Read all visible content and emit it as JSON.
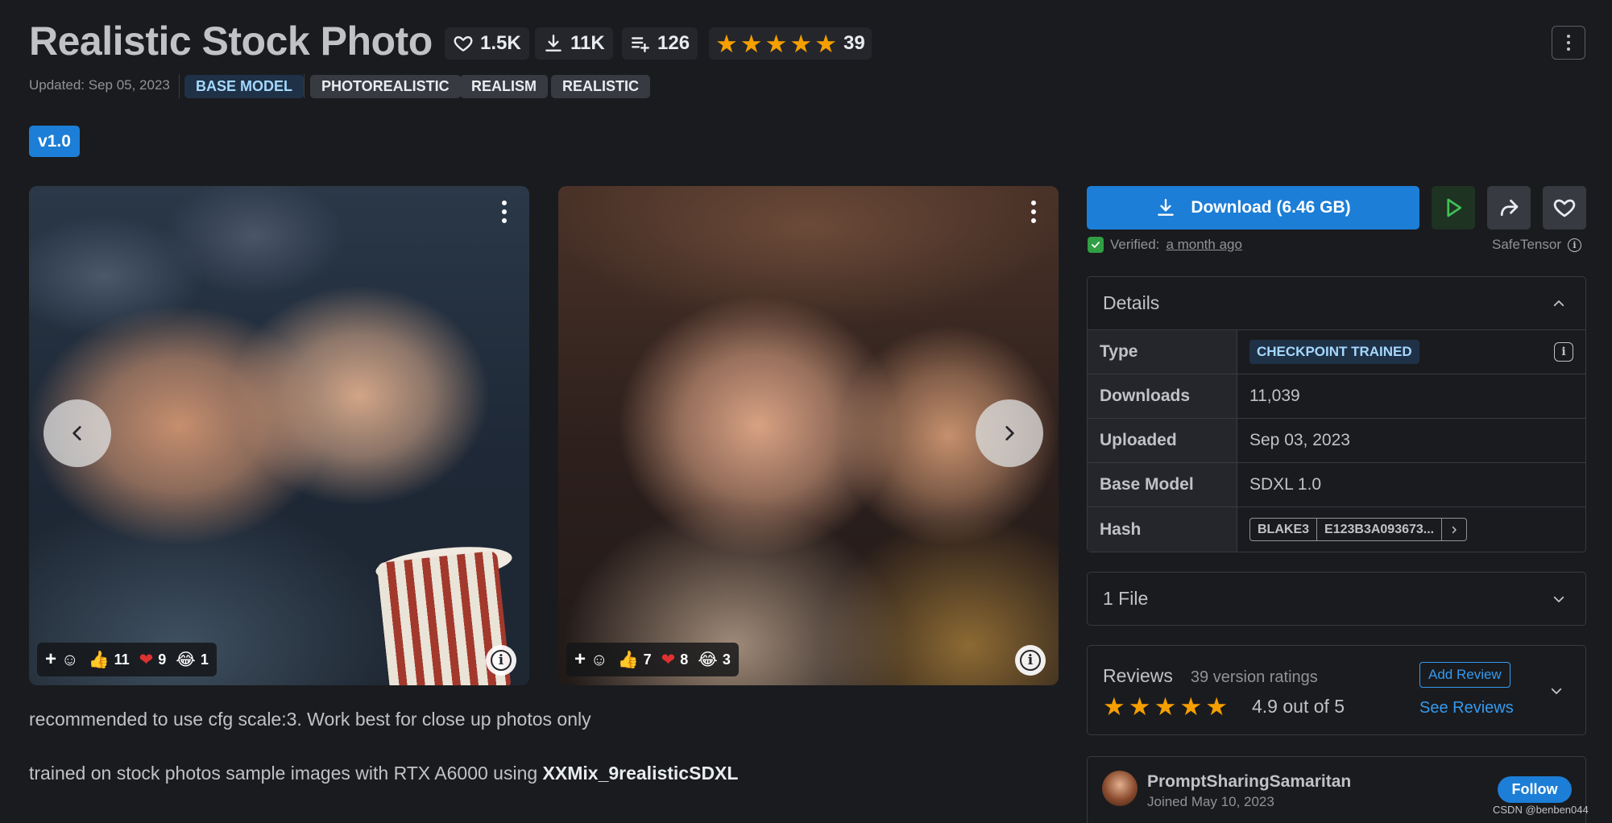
{
  "header": {
    "title": "Realistic Stock Photo",
    "likes": "1.5K",
    "downloads": "11K",
    "collections": "126",
    "rating_count": "39",
    "updated": "Updated: Sep 05, 2023",
    "tags": [
      "BASE MODEL",
      "PHOTOREALISTIC",
      "REALISM",
      "REALISTIC"
    ]
  },
  "version": {
    "label": "v1.0"
  },
  "gallery": {
    "cards": [
      {
        "reactions": {
          "thumbs": "11",
          "heart": "9",
          "laugh": "1"
        }
      },
      {
        "reactions": {
          "thumbs": "7",
          "heart": "8",
          "laugh": "3"
        }
      }
    ]
  },
  "description": {
    "line1": "recommended to use cfg scale:3. Work best for close up photos only",
    "line2_prefix": "trained on stock photos sample images with RTX A6000 using ",
    "line2_bold": "XXMix_9realisticSDXL"
  },
  "sidebar": {
    "download_label": "Download (6.46 GB)",
    "verified_prefix": "Verified: ",
    "verified_time": "a month ago",
    "format": "SafeTensor",
    "details": {
      "title": "Details",
      "rows": [
        {
          "key": "Type",
          "value": "CHECKPOINT TRAINED"
        },
        {
          "key": "Downloads",
          "value": "11,039"
        },
        {
          "key": "Uploaded",
          "value": "Sep 03, 2023"
        },
        {
          "key": "Base Model",
          "value": "SDXL 1.0"
        },
        {
          "key": "Hash",
          "hash_type": "BLAKE3",
          "hash_value": "E123B3A093673..."
        }
      ]
    },
    "files": {
      "title": "1 File"
    },
    "reviews": {
      "title": "Reviews",
      "subtitle": "39 version ratings",
      "add_label": "Add Review",
      "see_label": "See Reviews",
      "rating_text": "4.9 out of 5",
      "rating": 4.9
    },
    "creator": {
      "name": "PromptSharingSamaritan",
      "joined": "Joined May 10, 2023",
      "follow_label": "Follow"
    }
  },
  "watermark": "CSDN @benben044",
  "colors": {
    "accent": "#1c7ed6",
    "star": "#f59f00",
    "background": "#1a1b1e"
  }
}
